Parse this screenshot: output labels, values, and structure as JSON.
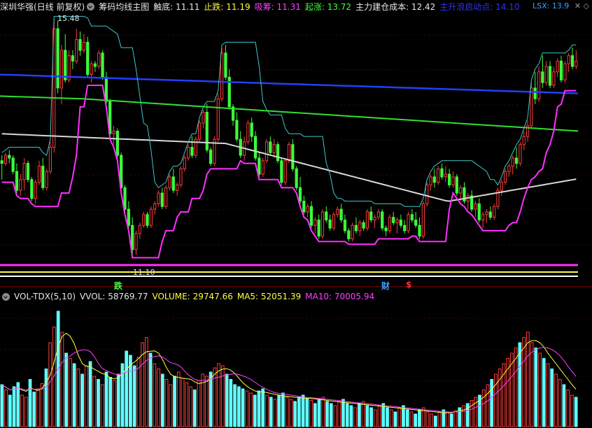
{
  "top_header": {
    "stock": "深圳华强(日线 前复权)",
    "indicator": "筹码均线主图",
    "items": [
      {
        "label": "触底: ",
        "value": "11.11",
        "color": "#e6e6e6"
      },
      {
        "label": "止跌: ",
        "value": "11.19",
        "color": "#ffff40"
      },
      {
        "label": "吸筹: ",
        "value": "11.31",
        "color": "#ff40ff"
      },
      {
        "label": "起涨: ",
        "value": "13.72",
        "color": "#40ff40"
      },
      {
        "label": "主力建仓成本: ",
        "value": "12.42",
        "color": "#e6e6e6"
      },
      {
        "label": "主升浪启动点: ",
        "value": "14.10",
        "color": "#3030ff"
      }
    ],
    "lsx": "LSX: 13.9",
    "icons": "✕ ◇"
  },
  "vol_header": {
    "indicator": "VOL-TDX(5,10)",
    "items": [
      {
        "label": "VVOL: ",
        "value": "58769.77",
        "color": "#e6e6e6"
      },
      {
        "label": "VOLUME: ",
        "value": "29747.66",
        "color": "#ffff40"
      },
      {
        "label": "MA5: ",
        "value": "52051.39",
        "color": "#ffff40"
      },
      {
        "label": "MA10: ",
        "value": "70005.94",
        "color": "#ff40ff"
      }
    ]
  },
  "markers": {
    "high_label": "15.48",
    "low_label": "11.10",
    "die": "跌",
    "cai": "财",
    "dollar": "$"
  },
  "chart_data": {
    "type": "candlestick",
    "price_range": [
      10.9,
      15.6
    ],
    "candles": [
      [
        12.85,
        12.95,
        12.5,
        12.8
      ],
      [
        12.8,
        13.0,
        12.75,
        12.95
      ],
      [
        12.95,
        13.05,
        12.8,
        12.9
      ],
      [
        12.9,
        12.95,
        12.6,
        12.65
      ],
      [
        12.65,
        12.8,
        12.25,
        12.3
      ],
      [
        12.3,
        12.6,
        12.2,
        12.5
      ],
      [
        12.5,
        12.9,
        12.3,
        12.8
      ],
      [
        12.8,
        12.85,
        12.45,
        12.5
      ],
      [
        12.5,
        12.55,
        12.1,
        12.15
      ],
      [
        12.15,
        12.5,
        12.05,
        12.45
      ],
      [
        12.45,
        12.85,
        12.4,
        12.75
      ],
      [
        12.75,
        12.9,
        12.3,
        12.35
      ],
      [
        12.35,
        12.7,
        12.3,
        12.65
      ],
      [
        12.65,
        13.2,
        12.6,
        13.1
      ],
      [
        13.1,
        15.48,
        13.0,
        15.3
      ],
      [
        15.3,
        15.45,
        14.1,
        14.2
      ],
      [
        14.2,
        15.0,
        13.9,
        14.9
      ],
      [
        14.9,
        15.2,
        14.3,
        14.35
      ],
      [
        14.35,
        14.9,
        14.3,
        14.8
      ],
      [
        14.8,
        14.9,
        14.55,
        14.7
      ],
      [
        14.7,
        15.3,
        14.65,
        15.1
      ],
      [
        15.1,
        15.25,
        14.8,
        14.9
      ],
      [
        14.9,
        15.2,
        14.85,
        15.05
      ],
      [
        15.05,
        15.15,
        14.4,
        14.45
      ],
      [
        14.45,
        14.7,
        14.3,
        14.65
      ],
      [
        14.65,
        14.7,
        14.5,
        14.6
      ],
      [
        14.6,
        14.9,
        14.55,
        14.85
      ],
      [
        14.85,
        14.9,
        14.35,
        14.4
      ],
      [
        14.4,
        14.5,
        13.9,
        13.95
      ],
      [
        13.95,
        14.0,
        13.3,
        13.35
      ],
      [
        13.35,
        13.5,
        13.15,
        13.4
      ],
      [
        13.4,
        13.45,
        12.9,
        12.95
      ],
      [
        12.95,
        13.0,
        12.3,
        12.35
      ],
      [
        12.35,
        12.4,
        11.9,
        11.95
      ],
      [
        11.95,
        12.1,
        11.6,
        11.65
      ],
      [
        11.65,
        11.8,
        11.1,
        11.2
      ],
      [
        11.2,
        11.55,
        11.1,
        11.5
      ],
      [
        11.5,
        11.7,
        11.4,
        11.65
      ],
      [
        11.65,
        11.9,
        11.6,
        11.85
      ],
      [
        11.85,
        11.9,
        11.6,
        11.65
      ],
      [
        11.65,
        12.0,
        11.6,
        11.95
      ],
      [
        11.95,
        12.1,
        11.85,
        12.05
      ],
      [
        12.05,
        12.3,
        12.0,
        12.25
      ],
      [
        12.25,
        12.35,
        11.95,
        12.0
      ],
      [
        12.0,
        12.4,
        11.95,
        12.35
      ],
      [
        12.35,
        12.6,
        12.3,
        12.55
      ],
      [
        12.55,
        12.7,
        12.25,
        12.3
      ],
      [
        12.3,
        12.45,
        12.2,
        12.4
      ],
      [
        12.4,
        12.75,
        12.35,
        12.7
      ],
      [
        12.7,
        12.95,
        12.65,
        12.9
      ],
      [
        12.9,
        13.15,
        12.85,
        13.1
      ],
      [
        13.1,
        13.3,
        12.9,
        12.95
      ],
      [
        12.95,
        13.3,
        12.9,
        13.25
      ],
      [
        13.25,
        13.6,
        13.2,
        13.55
      ],
      [
        13.55,
        13.8,
        13.45,
        13.75
      ],
      [
        13.75,
        13.9,
        13.0,
        13.05
      ],
      [
        13.05,
        13.1,
        12.75,
        12.8
      ],
      [
        12.8,
        13.3,
        12.75,
        13.25
      ],
      [
        13.25,
        14.1,
        13.2,
        14.0
      ],
      [
        14.0,
        14.95,
        13.95,
        14.85
      ],
      [
        14.85,
        15.0,
        14.35,
        14.4
      ],
      [
        14.4,
        14.55,
        13.8,
        13.85
      ],
      [
        13.85,
        13.9,
        13.5,
        13.6
      ],
      [
        13.6,
        13.75,
        13.2,
        13.25
      ],
      [
        13.25,
        13.4,
        12.9,
        12.95
      ],
      [
        12.95,
        13.3,
        12.85,
        13.2
      ],
      [
        13.2,
        13.6,
        13.15,
        13.55
      ],
      [
        13.55,
        13.65,
        13.2,
        13.3
      ],
      [
        13.3,
        13.4,
        12.85,
        12.9
      ],
      [
        12.9,
        13.0,
        12.55,
        12.6
      ],
      [
        12.6,
        12.9,
        12.55,
        12.85
      ],
      [
        12.85,
        13.25,
        12.8,
        13.2
      ],
      [
        13.2,
        13.3,
        12.95,
        13.0
      ],
      [
        13.0,
        13.25,
        12.9,
        13.15
      ],
      [
        13.15,
        13.2,
        12.8,
        12.85
      ],
      [
        12.85,
        12.9,
        12.4,
        12.45
      ],
      [
        12.45,
        12.9,
        12.4,
        12.85
      ],
      [
        12.85,
        13.2,
        12.8,
        13.15
      ],
      [
        13.15,
        13.25,
        12.65,
        12.7
      ],
      [
        12.7,
        12.75,
        12.3,
        12.35
      ],
      [
        12.35,
        12.55,
        12.05,
        12.1
      ],
      [
        12.1,
        12.2,
        11.85,
        11.9
      ],
      [
        11.9,
        12.05,
        11.8,
        12.0
      ],
      [
        12.0,
        12.1,
        11.6,
        11.65
      ],
      [
        11.65,
        11.8,
        11.5,
        11.75
      ],
      [
        11.75,
        11.85,
        11.4,
        11.45
      ],
      [
        11.45,
        11.95,
        11.4,
        11.9
      ],
      [
        11.9,
        12.0,
        11.7,
        11.75
      ],
      [
        11.75,
        11.85,
        11.55,
        11.6
      ],
      [
        11.6,
        11.9,
        11.55,
        11.85
      ],
      [
        11.85,
        12.0,
        11.8,
        11.95
      ],
      [
        11.95,
        12.05,
        11.7,
        11.75
      ],
      [
        11.75,
        11.85,
        11.5,
        11.55
      ],
      [
        11.55,
        11.6,
        11.35,
        11.4
      ],
      [
        11.4,
        11.7,
        11.35,
        11.65
      ],
      [
        11.65,
        11.8,
        11.5,
        11.55
      ],
      [
        11.55,
        11.75,
        11.45,
        11.7
      ],
      [
        11.7,
        11.75,
        11.55,
        11.6
      ],
      [
        11.6,
        11.95,
        11.55,
        11.9
      ],
      [
        11.9,
        12.0,
        11.7,
        11.75
      ],
      [
        11.75,
        11.85,
        11.6,
        11.8
      ],
      [
        11.8,
        11.95,
        11.75,
        11.9
      ],
      [
        11.9,
        11.95,
        11.55,
        11.6
      ],
      [
        11.6,
        11.65,
        11.45,
        11.55
      ],
      [
        11.55,
        11.85,
        11.5,
        11.8
      ],
      [
        11.8,
        11.9,
        11.65,
        11.7
      ],
      [
        11.7,
        11.8,
        11.5,
        11.75
      ],
      [
        11.75,
        11.85,
        11.6,
        11.65
      ],
      [
        11.65,
        11.75,
        11.5,
        11.55
      ],
      [
        11.55,
        11.9,
        11.5,
        11.85
      ],
      [
        11.85,
        11.95,
        11.7,
        11.75
      ],
      [
        11.75,
        11.9,
        11.6,
        11.65
      ],
      [
        11.65,
        11.8,
        11.4,
        11.45
      ],
      [
        11.45,
        12.1,
        11.4,
        12.05
      ],
      [
        12.05,
        12.45,
        12.0,
        12.4
      ],
      [
        12.4,
        12.6,
        12.3,
        12.55
      ],
      [
        12.55,
        12.7,
        12.35,
        12.45
      ],
      [
        12.45,
        12.75,
        12.4,
        12.7
      ],
      [
        12.7,
        12.8,
        12.5,
        12.55
      ],
      [
        12.55,
        12.75,
        12.45,
        12.6
      ],
      [
        12.6,
        12.7,
        12.35,
        12.4
      ],
      [
        12.4,
        12.65,
        12.35,
        12.55
      ],
      [
        12.55,
        12.6,
        12.2,
        12.25
      ],
      [
        12.25,
        12.4,
        12.1,
        12.35
      ],
      [
        12.35,
        12.45,
        12.05,
        12.1
      ],
      [
        12.1,
        12.25,
        11.95,
        12.2
      ],
      [
        12.2,
        12.3,
        11.9,
        11.95
      ],
      [
        11.95,
        12.1,
        11.8,
        12.05
      ],
      [
        12.05,
        12.15,
        11.7,
        11.75
      ],
      [
        11.75,
        11.9,
        11.6,
        11.85
      ],
      [
        11.85,
        11.95,
        11.7,
        11.9
      ],
      [
        11.9,
        12.0,
        11.75,
        11.8
      ],
      [
        11.8,
        12.05,
        11.75,
        12.0
      ],
      [
        12.0,
        12.35,
        11.95,
        12.3
      ],
      [
        12.3,
        12.5,
        12.2,
        12.45
      ],
      [
        12.45,
        12.7,
        12.4,
        12.65
      ],
      [
        12.65,
        12.8,
        12.55,
        12.75
      ],
      [
        12.75,
        12.95,
        12.6,
        12.9
      ],
      [
        12.9,
        13.1,
        12.7,
        12.8
      ],
      [
        12.8,
        13.2,
        12.75,
        13.15
      ],
      [
        13.15,
        13.4,
        13.05,
        13.3
      ],
      [
        13.3,
        13.6,
        13.2,
        13.5
      ],
      [
        13.5,
        14.3,
        13.45,
        14.2
      ],
      [
        14.2,
        14.5,
        13.9,
        14.0
      ],
      [
        14.0,
        14.6,
        13.95,
        14.5
      ],
      [
        14.5,
        14.8,
        14.2,
        14.3
      ],
      [
        14.3,
        14.7,
        14.25,
        14.6
      ],
      [
        14.6,
        14.7,
        14.2,
        14.25
      ],
      [
        14.25,
        14.6,
        14.2,
        14.5
      ],
      [
        14.5,
        14.75,
        14.4,
        14.7
      ],
      [
        14.7,
        14.8,
        14.3,
        14.35
      ],
      [
        14.35,
        14.7,
        14.3,
        14.65
      ],
      [
        14.65,
        14.85,
        14.5,
        14.8
      ],
      [
        14.8,
        14.95,
        14.55,
        14.6
      ],
      [
        14.6,
        14.9,
        14.55,
        14.7
      ]
    ],
    "ma_blue": [
      14.45,
      14.44,
      14.43,
      14.42,
      14.41,
      14.4,
      14.39,
      14.38,
      14.37,
      14.36,
      14.35,
      14.34,
      14.33,
      14.32,
      14.31,
      14.3,
      14.29,
      14.28,
      14.27,
      14.26,
      14.25,
      14.24,
      14.23,
      14.22,
      14.21,
      14.2,
      14.19,
      14.18,
      14.17,
      14.16,
      14.15,
      14.14,
      14.13,
      14.12,
      14.11,
      14.1
    ],
    "ma_green": [
      14.05,
      14.04,
      14.03,
      14.02,
      14.01,
      14.0,
      13.98,
      13.96,
      13.94,
      13.92,
      13.9,
      13.88,
      13.86,
      13.84,
      13.82,
      13.8,
      13.78,
      13.76,
      13.74,
      13.72,
      13.7,
      13.68,
      13.66,
      13.64,
      13.62,
      13.6,
      13.58,
      13.56,
      13.54,
      13.52,
      13.5,
      13.48,
      13.46,
      13.44,
      13.42,
      13.4
    ],
    "volume": [
      40,
      35,
      30,
      38,
      42,
      30,
      28,
      45,
      33,
      36,
      41,
      55,
      80,
      95,
      110,
      90,
      70,
      65,
      60,
      55,
      50,
      58,
      62,
      48,
      45,
      40,
      52,
      47,
      44,
      50,
      60,
      72,
      68,
      58,
      66,
      80,
      85,
      70,
      60,
      55,
      50,
      45,
      40,
      48,
      52,
      46,
      42,
      38,
      35,
      44,
      50,
      48,
      52,
      56,
      60,
      58,
      50,
      45,
      40,
      38,
      36,
      34,
      32,
      30,
      34,
      36,
      30,
      28,
      26,
      30,
      32,
      28,
      26,
      24,
      28,
      30,
      27,
      25,
      22,
      26,
      28,
      24,
      22,
      20,
      24,
      26,
      22,
      20,
      18,
      22,
      24,
      20,
      18,
      16,
      20,
      22,
      18,
      16,
      14,
      18,
      20,
      16,
      14,
      12,
      16,
      18,
      14,
      12,
      10,
      14,
      16,
      14,
      12,
      15,
      18,
      20,
      22,
      25,
      28,
      30,
      35,
      40,
      45,
      50,
      55,
      60,
      65,
      70,
      75,
      80,
      85,
      90,
      80,
      75,
      70,
      65,
      60,
      55,
      50,
      45,
      40,
      35,
      30,
      28
    ],
    "vol_range": [
      0,
      120
    ]
  }
}
